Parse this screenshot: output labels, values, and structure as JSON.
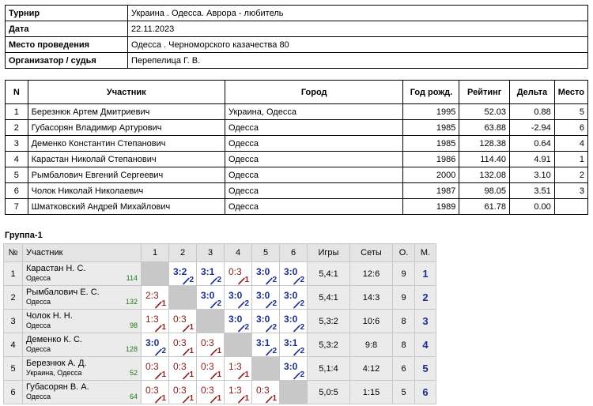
{
  "info": [
    {
      "label": "Турнир",
      "value": "Украина . Одесса. Аврора  - любитель"
    },
    {
      "label": "Дата",
      "value": "22.11.2023"
    },
    {
      "label": "Место проведения",
      "value": "Одесса . Черноморского казачества 80"
    },
    {
      "label": "Организатор / судья",
      "value": "Перепелица Г. В."
    }
  ],
  "participants": {
    "headers": [
      "N",
      "Участник",
      "Город",
      "Год рожд.",
      "Рейтинг",
      "Дельта",
      "Место"
    ],
    "rows": [
      [
        "1",
        "Березнюк Артем Дмитриевич",
        "Украина, Одесса",
        "1995",
        "52.03",
        "0.88",
        "5"
      ],
      [
        "2",
        "Губасорян Владимир Артурович",
        "Одесса",
        "1985",
        "63.88",
        "-2.94",
        "6"
      ],
      [
        "3",
        "Деменко Константин Степанович",
        "Одесса",
        "1985",
        "128.38",
        "0.64",
        "4"
      ],
      [
        "4",
        "Карастан Николай Степанович",
        "Одесса",
        "1986",
        "114.40",
        "4.91",
        "1"
      ],
      [
        "5",
        "Рымбалович Евгений Сергеевич",
        "Одесса",
        "2000",
        "132.08",
        "3.10",
        "2"
      ],
      [
        "6",
        "Чолок Николай Николаевич",
        "Одесса",
        "1987",
        "98.05",
        "3.51",
        "3"
      ],
      [
        "7",
        "Шматковский Андрей Михайлович",
        "Одесса",
        "1989",
        "61.78",
        "0.00",
        ""
      ]
    ]
  },
  "group": {
    "title": "Группа-1",
    "headers": {
      "num": "№",
      "player": "Участник",
      "cols": [
        "1",
        "2",
        "3",
        "4",
        "5",
        "6"
      ],
      "games": "Игры",
      "sets": "Сеты",
      "points": "О.",
      "place": "М."
    },
    "colors": {
      "win": "#1c2f8c",
      "loss": "#8a2020",
      "rating": "#1a7a1a",
      "diag": "#c8c8c8"
    },
    "rows": [
      {
        "num": "1",
        "name": "Карастан Н. С.",
        "city": "Одесса",
        "rating": "114",
        "results": [
          null,
          [
            "3:2",
            "2"
          ],
          [
            "3:1",
            "2"
          ],
          [
            "0:3",
            "1"
          ],
          [
            "3:0",
            "2"
          ],
          [
            "3:0",
            "2"
          ]
        ],
        "games": "5,4:1",
        "sets": "12:6",
        "points": "9",
        "place": "1"
      },
      {
        "num": "2",
        "name": "Рымбалович Е. С.",
        "city": "Одесса",
        "rating": "132",
        "results": [
          [
            "2:3",
            "1"
          ],
          null,
          [
            "3:0",
            "2"
          ],
          [
            "3:0",
            "2"
          ],
          [
            "3:0",
            "2"
          ],
          [
            "3:0",
            "2"
          ]
        ],
        "games": "5,4:1",
        "sets": "14:3",
        "points": "9",
        "place": "2"
      },
      {
        "num": "3",
        "name": "Чолок Н. Н.",
        "city": "Одесса",
        "rating": "98",
        "results": [
          [
            "1:3",
            "1"
          ],
          [
            "0:3",
            "1"
          ],
          null,
          [
            "3:0",
            "2"
          ],
          [
            "3:0",
            "2"
          ],
          [
            "3:0",
            "2"
          ]
        ],
        "games": "5,3:2",
        "sets": "10:6",
        "points": "8",
        "place": "3"
      },
      {
        "num": "4",
        "name": "Деменко К. С.",
        "city": "Одесса",
        "rating": "128",
        "results": [
          [
            "3:0",
            "2"
          ],
          [
            "0:3",
            "1"
          ],
          [
            "0:3",
            "1"
          ],
          null,
          [
            "3:1",
            "2"
          ],
          [
            "3:1",
            "2"
          ]
        ],
        "games": "5,3:2",
        "sets": "9:8",
        "points": "8",
        "place": "4"
      },
      {
        "num": "5",
        "name": "Березнюк А. Д.",
        "city": "Украина, Одесса",
        "rating": "52",
        "results": [
          [
            "0:3",
            "1"
          ],
          [
            "0:3",
            "1"
          ],
          [
            "0:3",
            "1"
          ],
          [
            "1:3",
            "1"
          ],
          null,
          [
            "3:0",
            "2"
          ]
        ],
        "games": "5,1:4",
        "sets": "4:12",
        "points": "6",
        "place": "5"
      },
      {
        "num": "6",
        "name": "Губасорян В. А.",
        "city": "Одесса",
        "rating": "64",
        "results": [
          [
            "0:3",
            "1"
          ],
          [
            "0:3",
            "1"
          ],
          [
            "0:3",
            "1"
          ],
          [
            "1:3",
            "1"
          ],
          [
            "0:3",
            "1"
          ],
          null
        ],
        "games": "5,0:5",
        "sets": "1:15",
        "points": "5",
        "place": "6"
      }
    ]
  }
}
